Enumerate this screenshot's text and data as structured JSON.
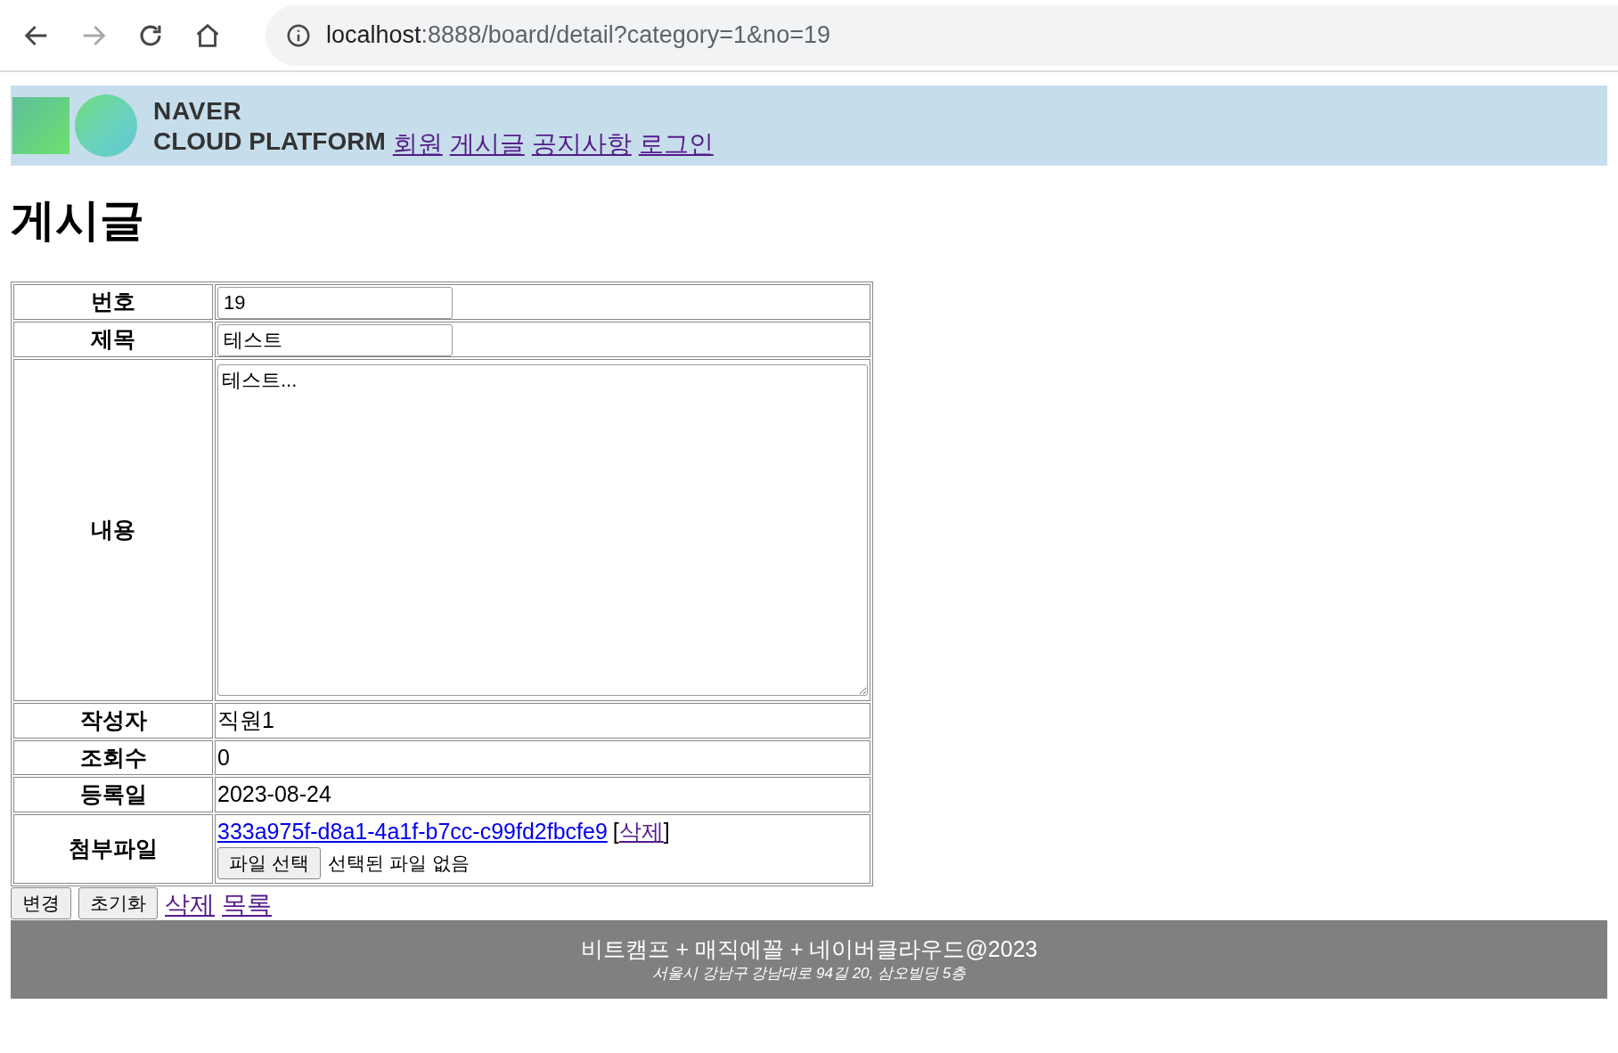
{
  "browser": {
    "url_host": "localhost",
    "url_path": ":8888/board/detail?category=1&no=19"
  },
  "header": {
    "logo_line_1": "NAVER",
    "logo_line_2": "CLOUD PLATFORM",
    "nav": [
      "회원",
      "게시글",
      "공지사항",
      "로그인"
    ]
  },
  "title": "게시글",
  "form": {
    "rows": [
      {
        "kind": "input",
        "label": "번호",
        "value": "19"
      },
      {
        "kind": "input",
        "label": "제목",
        "value": "테스트"
      },
      {
        "kind": "textarea",
        "label": "내용",
        "value": "테스트..."
      },
      {
        "kind": "text",
        "label": "작성자",
        "value": "직원1"
      },
      {
        "kind": "text",
        "label": "조회수",
        "value": "0"
      },
      {
        "kind": "text",
        "label": "등록일",
        "value": "2023-08-24"
      },
      {
        "kind": "file",
        "label": "첨부파일",
        "file_link": "333a975f-d8a1-4a1f-b7cc-c99fd2fbcfe9",
        "open_bracket": "[",
        "delete_link": "삭제",
        "close_bracket": "]",
        "choose_button": "파일 선택",
        "no_file_text": "선택된 파일 없음"
      }
    ]
  },
  "actions": [
    {
      "kind": "button",
      "label": "변경"
    },
    {
      "kind": "button",
      "label": "초기화"
    },
    {
      "kind": "link",
      "label": "삭제"
    },
    {
      "kind": "link",
      "label": "목록"
    }
  ],
  "footer": {
    "line_1": "비트캠프 + 매직에꼴 + 네이버클라우드@2023",
    "line_2": "서울시 강남구 강남대로 94길 20, 삼오빌딩 5층"
  }
}
